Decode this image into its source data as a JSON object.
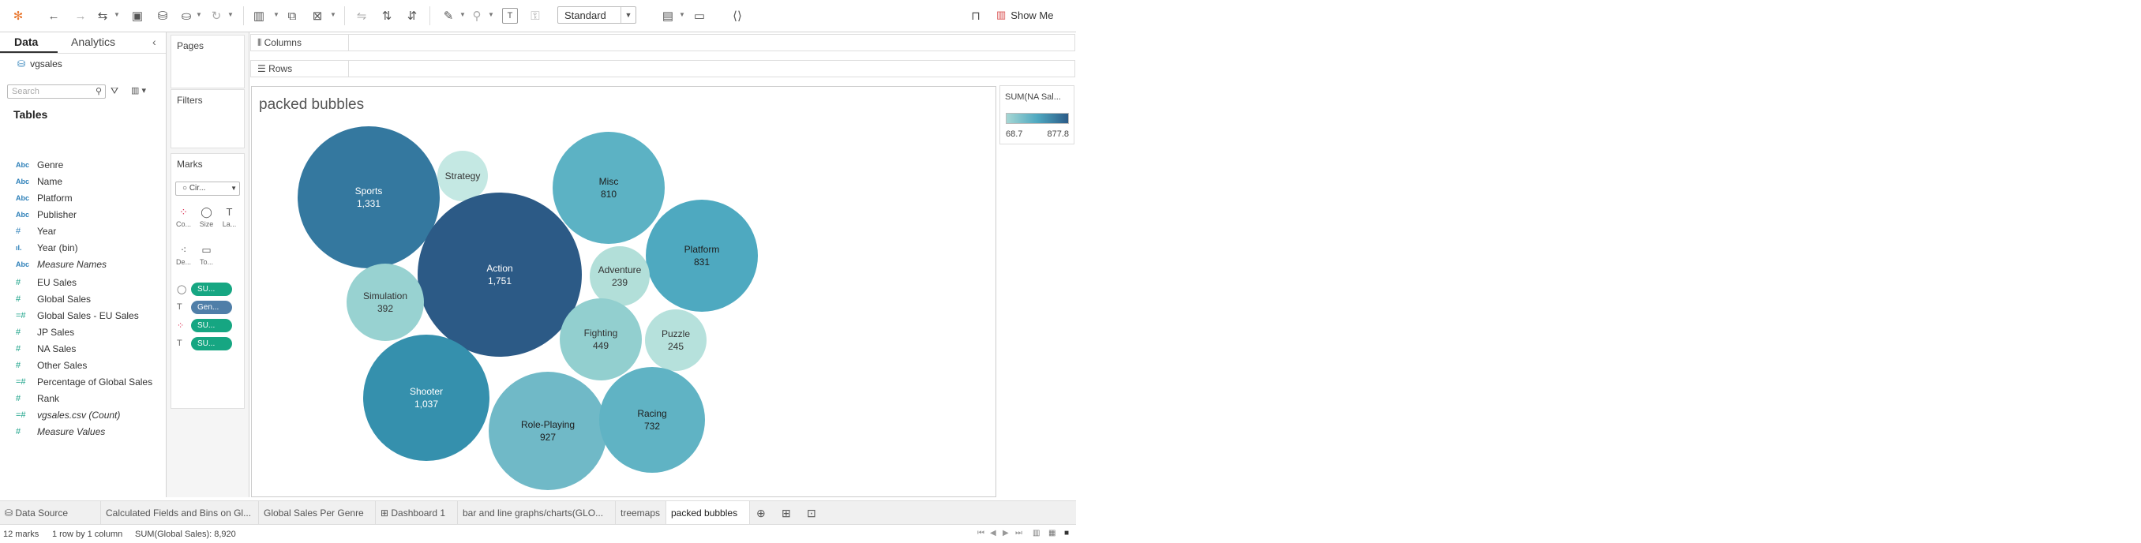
{
  "toolbar": {
    "view_size": "Standard",
    "show_me": "Show Me"
  },
  "data_pane": {
    "tab_data": "Data",
    "tab_analytics": "Analytics",
    "data_source": "vgsales",
    "search_placeholder": "Search",
    "tables_heading": "Tables",
    "fields": [
      {
        "type": "Abc",
        "name": "Genre"
      },
      {
        "type": "Abc",
        "name": "Name"
      },
      {
        "type": "Abc",
        "name": "Platform"
      },
      {
        "type": "Abc",
        "name": "Publisher"
      },
      {
        "type": "#",
        "name": "Year"
      },
      {
        "type": "ıl.",
        "name": "Year (bin)"
      },
      {
        "type": "Abc",
        "name": "Measure Names"
      },
      {
        "type": "#",
        "name": "EU Sales"
      },
      {
        "type": "#",
        "name": "Global Sales"
      },
      {
        "type": "=#",
        "name": "Global Sales - EU Sales"
      },
      {
        "type": "#",
        "name": "JP Sales"
      },
      {
        "type": "#",
        "name": "NA Sales"
      },
      {
        "type": "#",
        "name": "Other Sales"
      },
      {
        "type": "=#",
        "name": "Percentage of Global Sales"
      },
      {
        "type": "#",
        "name": "Rank"
      },
      {
        "type": "=#",
        "name": "vgsales.csv (Count)"
      },
      {
        "type": "#",
        "name": "Measure Values"
      }
    ]
  },
  "cards": {
    "pages": "Pages",
    "filters": "Filters",
    "marks": "Marks",
    "mark_type": "Cir...",
    "buttons": [
      "Co...",
      "Size",
      "La...",
      "De...",
      "To..."
    ],
    "pills": [
      "SU...",
      "Gen...",
      "SU...",
      "SU..."
    ]
  },
  "shelves": {
    "columns": "Columns",
    "rows": "Rows"
  },
  "view": {
    "title": "packed bubbles"
  },
  "legend": {
    "title": "SUM(NA Sal...",
    "min": "68.7",
    "max": "877.8"
  },
  "chart_data": {
    "type": "packed bubbles",
    "size_measure": "SUM(Global Sales)",
    "color_measure": "SUM(NA Sales)",
    "color_range": [
      68.7,
      877.8
    ],
    "bubbles": [
      {
        "label": "Sports",
        "value": "1,331",
        "color": "#34789f",
        "text_color": "#ffffff"
      },
      {
        "label": "Strategy",
        "value": "",
        "color": "#c4e8e3",
        "text_color": "#333333"
      },
      {
        "label": "Misc",
        "value": "810",
        "color": "#5cb2c4",
        "text_color": "#1d1d1d"
      },
      {
        "label": "Action",
        "value": "1,751",
        "color": "#2c5a86",
        "text_color": "#ffffff"
      },
      {
        "label": "Platform",
        "value": "831",
        "color": "#4ea9c0",
        "text_color": "#1d1d1d"
      },
      {
        "label": "Adventure",
        "value": "239",
        "color": "#b2dfd9",
        "text_color": "#333333"
      },
      {
        "label": "Simulation",
        "value": "392",
        "color": "#98d2d1",
        "text_color": "#333333"
      },
      {
        "label": "Fighting",
        "value": "449",
        "color": "#92cfcf",
        "text_color": "#333333"
      },
      {
        "label": "Puzzle",
        "value": "245",
        "color": "#b6e1dc",
        "text_color": "#333333"
      },
      {
        "label": "Shooter",
        "value": "1,037",
        "color": "#3590ad",
        "text_color": "#ffffff"
      },
      {
        "label": "Role-Playing",
        "value": "927",
        "color": "#70b9c7",
        "text_color": "#1d1d1d"
      },
      {
        "label": "Racing",
        "value": "732",
        "color": "#60b3c4",
        "text_color": "#1d1d1d"
      }
    ]
  },
  "sheet_tabs": [
    "Data Source",
    "Calculated Fields and Bins on Gl...",
    "Global Sales Per Genre",
    "Dashboard 1",
    "bar and line graphs/charts(GLO...",
    "treemaps",
    "packed bubbles"
  ],
  "status": {
    "marks": "12 marks",
    "rows_cols": "1 row by 1 column",
    "sum": "SUM(Global Sales): 8,920"
  }
}
